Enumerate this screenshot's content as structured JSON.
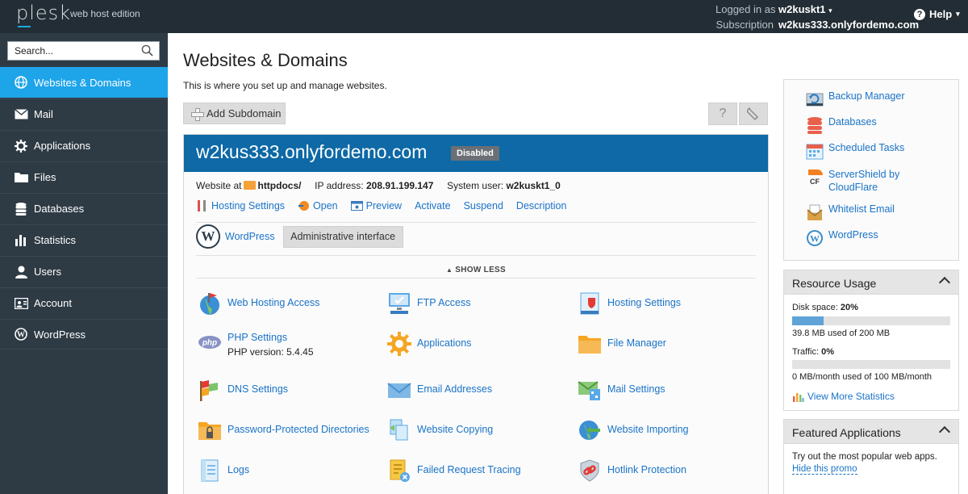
{
  "topbar": {
    "logo": "plesk",
    "edition": "web host edition",
    "logged_in_label": "Logged in as",
    "user": "w2kuskt1",
    "subscription_label": "Subscription",
    "subscription": "w2kus333.onlyfordemo.com",
    "help": "Help"
  },
  "sidebar": {
    "search_placeholder": "Search...",
    "items": [
      {
        "label": "Websites & Domains",
        "icon": "globe-icon",
        "active": true
      },
      {
        "label": "Mail",
        "icon": "envelope-icon"
      },
      {
        "label": "Applications",
        "icon": "gear-icon"
      },
      {
        "label": "Files",
        "icon": "folder-icon"
      },
      {
        "label": "Databases",
        "icon": "database-icon"
      },
      {
        "label": "Statistics",
        "icon": "bar-chart-icon"
      },
      {
        "label": "Users",
        "icon": "user-icon"
      },
      {
        "label": "Account",
        "icon": "account-icon"
      },
      {
        "label": "WordPress",
        "icon": "wordpress-icon"
      }
    ]
  },
  "main": {
    "title": "Websites & Domains",
    "description": "This is where you set up and manage websites.",
    "add_subdomain": "Add Subdomain",
    "help_btn": "?",
    "domain": {
      "name": "w2kus333.onlyfordemo.com",
      "status": "Disabled",
      "website_at_label": "Website at",
      "docroot": "httpdocs/",
      "ip_label": "IP address:",
      "ip": "208.91.199.147",
      "sysuser_label": "System user:",
      "sysuser": "w2kuskt1_0",
      "actions": [
        "Hosting Settings",
        "Open",
        "Preview",
        "Activate",
        "Suspend",
        "Description"
      ],
      "wordpress_label": "WordPress",
      "admin_interface": "Administrative interface",
      "show_less": "SHOW LESS",
      "tools": [
        {
          "label": "Web Hosting Access",
          "icon": "web-hosting-access-icon"
        },
        {
          "label": "FTP Access",
          "icon": "ftp-access-icon"
        },
        {
          "label": "Hosting Settings",
          "icon": "hosting-settings-icon"
        },
        {
          "label": "PHP Settings",
          "icon": "php-icon",
          "sub": "PHP version: 5.4.45"
        },
        {
          "label": "Applications",
          "icon": "applications-gear-icon"
        },
        {
          "label": "File Manager",
          "icon": "file-manager-icon"
        },
        {
          "label": "DNS Settings",
          "icon": "dns-settings-icon"
        },
        {
          "label": "Email Addresses",
          "icon": "email-addresses-icon"
        },
        {
          "label": "Mail Settings",
          "icon": "mail-settings-icon"
        },
        {
          "label": "Password-Protected Directories",
          "icon": "protected-directories-icon"
        },
        {
          "label": "Website Copying",
          "icon": "website-copying-icon"
        },
        {
          "label": "Website Importing",
          "icon": "website-importing-icon"
        },
        {
          "label": "Logs",
          "icon": "logs-icon"
        },
        {
          "label": "Failed Request Tracing",
          "icon": "failed-request-tracing-icon"
        },
        {
          "label": "Hotlink Protection",
          "icon": "hotlink-protection-icon"
        }
      ]
    }
  },
  "right": {
    "links": [
      {
        "label": "Backup Manager",
        "icon": "backup-manager-icon"
      },
      {
        "label": "Databases",
        "icon": "databases-icon"
      },
      {
        "label": "Scheduled Tasks",
        "icon": "scheduled-tasks-icon"
      },
      {
        "label": "ServerShield by CloudFlare",
        "icon": "cloudflare-icon"
      },
      {
        "label": "Whitelist Email",
        "icon": "whitelist-email-icon"
      },
      {
        "label": "WordPress",
        "icon": "wordpress-icon"
      }
    ],
    "resource_usage": {
      "title": "Resource Usage",
      "disk_label": "Disk space:",
      "disk_pct": "20%",
      "disk_fraction": 0.2,
      "disk_detail": "39.8 MB used of 200 MB",
      "traffic_label": "Traffic:",
      "traffic_pct": "0%",
      "traffic_fraction": 0,
      "traffic_detail": "0 MB/month used of 100 MB/month",
      "more_stats": "View More Statistics"
    },
    "featured": {
      "title": "Featured Applications",
      "text": "Try out the most popular web apps.",
      "hide": "Hide this promo"
    }
  },
  "colors": {
    "topbar": "#222d35",
    "sidebar": "#2e3b45",
    "active": "#1ea4e9",
    "domain_header": "#0e69a6",
    "link": "#1a73c8"
  }
}
